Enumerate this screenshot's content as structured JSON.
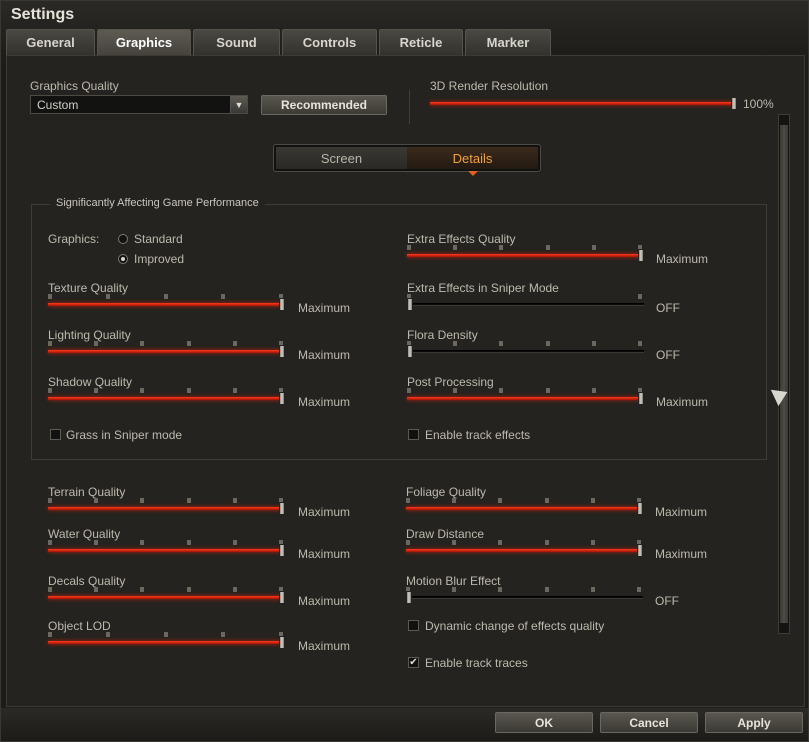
{
  "window": {
    "title": "Settings"
  },
  "tabs": [
    "General",
    "Graphics",
    "Sound",
    "Controls",
    "Reticle",
    "Marker"
  ],
  "active_tab": "Graphics",
  "quality": {
    "label": "Graphics Quality",
    "value": "Custom",
    "recommended_label": "Recommended"
  },
  "render": {
    "label": "3D Render Resolution",
    "value_text": "100%",
    "level": 1.0
  },
  "subtabs": {
    "screen": "Screen",
    "details": "Details"
  },
  "group": {
    "title": "Significantly Affecting Game Performance",
    "graphics_label": "Graphics:",
    "standard": "Standard",
    "improved": "Improved",
    "selected": "Improved",
    "grass_sniper": "Grass in Sniper mode",
    "grass_sniper_checked": false,
    "track_effects": "Enable track effects",
    "track_effects_checked": false
  },
  "sliders": {
    "texture": {
      "label": "Texture Quality",
      "value": "Maximum",
      "level": 1.0
    },
    "lighting": {
      "label": "Lighting Quality",
      "value": "Maximum",
      "level": 1.0
    },
    "shadow": {
      "label": "Shadow Quality",
      "value": "Maximum",
      "level": 1.0
    },
    "extra_effects": {
      "label": "Extra Effects Quality",
      "value": "Maximum",
      "level": 1.0
    },
    "extra_sniper": {
      "label": "Extra Effects in Sniper Mode",
      "value": "OFF",
      "level": 0.0
    },
    "flora": {
      "label": "Flora Density",
      "value": "OFF",
      "level": 0.0
    },
    "post": {
      "label": "Post Processing",
      "value": "Maximum",
      "level": 1.0
    },
    "terrain": {
      "label": "Terrain Quality",
      "value": "Maximum",
      "level": 1.0
    },
    "water": {
      "label": "Water Quality",
      "value": "Maximum",
      "level": 1.0
    },
    "decals": {
      "label": "Decals Quality",
      "value": "Maximum",
      "level": 1.0
    },
    "object_lod": {
      "label": "Object LOD",
      "value": "Maximum",
      "level": 1.0
    },
    "foliage": {
      "label": "Foliage Quality",
      "value": "Maximum",
      "level": 1.0
    },
    "draw_distance": {
      "label": "Draw Distance",
      "value": "Maximum",
      "level": 1.0
    },
    "motion_blur": {
      "label": "Motion Blur Effect",
      "value": "OFF",
      "level": 0.0
    }
  },
  "checks": {
    "dynamic": {
      "label": "Dynamic change of effects quality",
      "checked": false
    },
    "track_traces": {
      "label": "Enable track traces",
      "checked": true
    }
  },
  "footer": {
    "ok": "OK",
    "cancel": "Cancel",
    "apply": "Apply"
  }
}
